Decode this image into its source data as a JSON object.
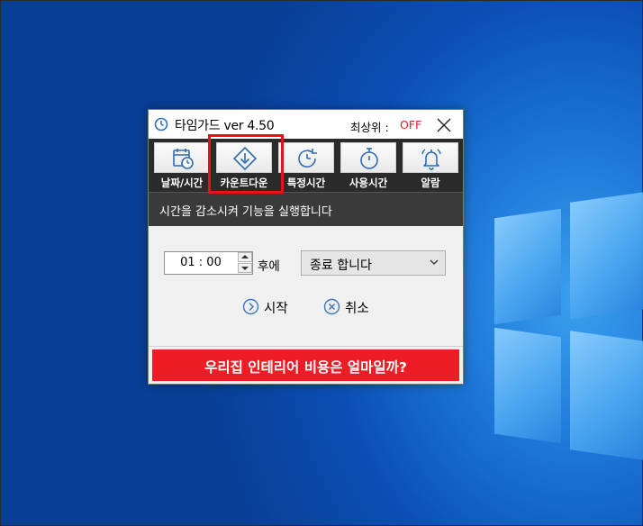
{
  "app": {
    "title": "타임가드 ver 4.50",
    "topmost_label": "최상위 :",
    "topmost_value": "OFF",
    "topmost_color": "#e02020"
  },
  "toolbar": {
    "items": [
      {
        "label": "날짜/시간",
        "icon": "calendar-clock-icon"
      },
      {
        "label": "카운트다운",
        "icon": "countdown-arrow-icon",
        "highlighted": true
      },
      {
        "label": "특정시간",
        "icon": "refresh-clock-icon"
      },
      {
        "label": "사용시간",
        "icon": "stopwatch-icon"
      },
      {
        "label": "알람",
        "icon": "bell-icon"
      }
    ]
  },
  "description": "시간을 감소시켜 기능을 실행합니다",
  "timer": {
    "value": "01 : 00",
    "after_label": "후에"
  },
  "action": {
    "selected": "종료 합니다"
  },
  "buttons": {
    "start": "시작",
    "cancel": "취소"
  },
  "ad": {
    "text": "우리집 인테리어 비용은 얼마일까?",
    "color": "#ee1c25"
  },
  "accent_color": "#3a78c2"
}
